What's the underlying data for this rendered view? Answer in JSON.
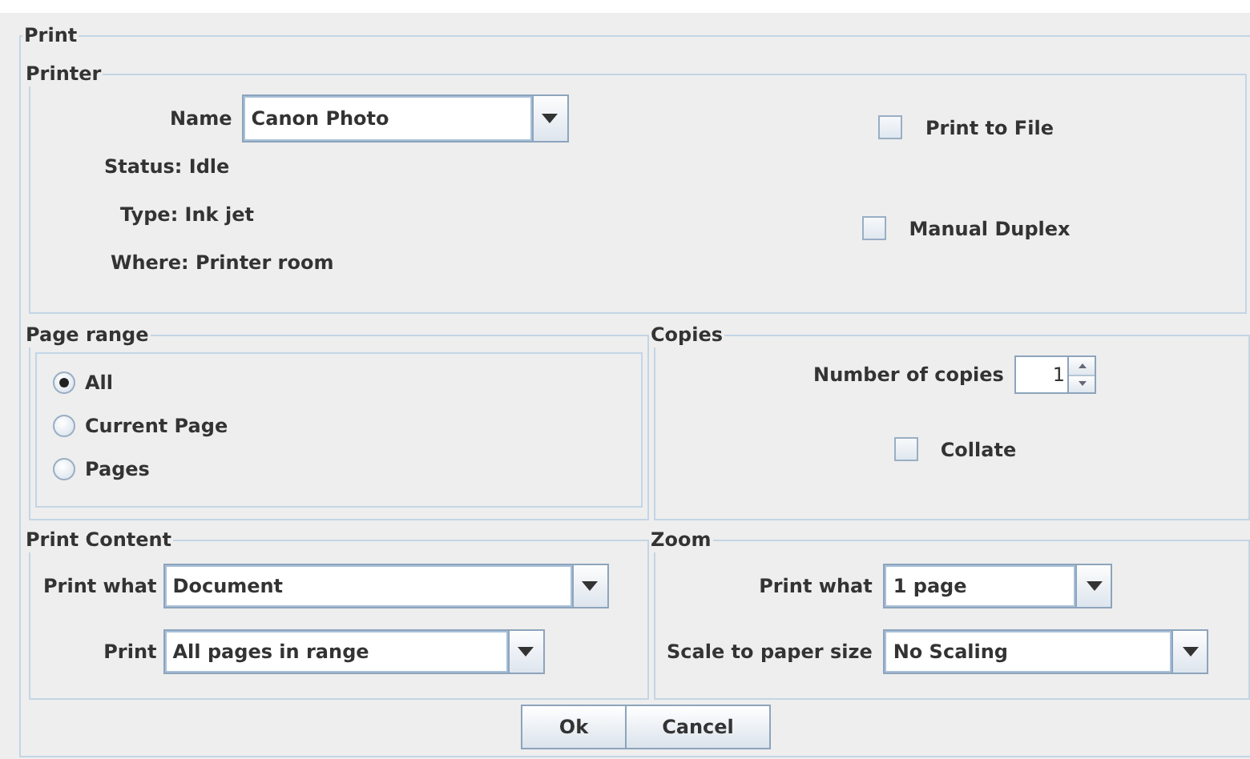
{
  "dialog": {
    "title": "Print"
  },
  "printer": {
    "title": "Printer",
    "name_label": "Name",
    "name_value": "Canon Photo",
    "info": [
      "Status: Idle",
      "Type: Ink jet",
      "Where: Printer room"
    ],
    "options": [
      {
        "label": "Print to File",
        "checked": false
      },
      {
        "label": "Manual Duplex",
        "checked": false
      }
    ]
  },
  "page_range": {
    "title": "Page range",
    "options": [
      {
        "label": "All",
        "selected": true
      },
      {
        "label": "Current Page",
        "selected": false
      },
      {
        "label": "Pages",
        "selected": false
      }
    ]
  },
  "copies": {
    "title": "Copies",
    "label": "Number of copies",
    "value": "1",
    "collate": {
      "label": "Collate",
      "checked": false
    }
  },
  "print_content": {
    "title": "Print Content",
    "fields": [
      {
        "label": "Print what",
        "value": "Document"
      },
      {
        "label": "Print",
        "value": "All pages in range"
      }
    ]
  },
  "zoom": {
    "title": "Zoom",
    "fields": [
      {
        "label": "Print what",
        "value": "1 page"
      },
      {
        "label": "Scale to paper size",
        "value": "No Scaling"
      }
    ]
  },
  "buttons": [
    "Ok",
    "Cancel"
  ]
}
